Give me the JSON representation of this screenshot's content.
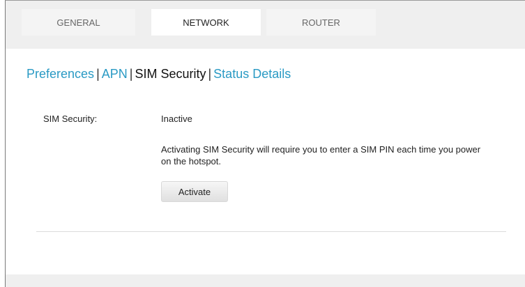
{
  "tabs": [
    {
      "label": "GENERAL",
      "active": false
    },
    {
      "label": "NETWORK",
      "active": true
    },
    {
      "label": "ROUTER",
      "active": false
    }
  ],
  "subnav": {
    "items": [
      {
        "label": "Preferences",
        "current": false
      },
      {
        "label": "APN",
        "current": false
      },
      {
        "label": "SIM Security",
        "current": true
      },
      {
        "label": "Status Details",
        "current": false
      }
    ],
    "separator": "|"
  },
  "sim_security": {
    "label": "SIM Security:",
    "status": "Inactive",
    "description": "Activating SIM Security will require you to enter a SIM PIN each time you power on the hotspot.",
    "activate_label": "Activate"
  },
  "colors": {
    "link": "#2a9ac4",
    "background": "#efefef",
    "panel": "#ffffff"
  }
}
